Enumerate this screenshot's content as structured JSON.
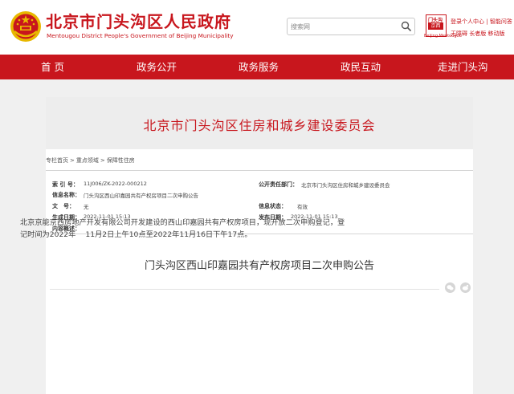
{
  "header": {
    "title": "北京市门头沟区人民政府",
    "subtitle": "Mentougou District People's Government of Beijing Municipality",
    "search_placeholder": "搜索网",
    "logo_top": "门头沟",
    "logo_mid": "京西",
    "logo_text": "Beijing·Mentougou",
    "links_row1": [
      "登录个人中心",
      "智能问答"
    ],
    "links_row2": [
      "无障碍",
      "长者版",
      "移动版"
    ]
  },
  "nav": {
    "items": [
      "首 页",
      "政务公开",
      "政务服务",
      "政民互动",
      "走进门头沟"
    ]
  },
  "banner": {
    "title": "北京市门头沟区住房和城乡建设委员会"
  },
  "breadcrumb": [
    "专栏首页",
    "重点领域",
    "保障性住房"
  ],
  "meta": {
    "index_label": "索 引 号：",
    "index_value": "11J006/ZK-2022-000212",
    "org_label": "公开责任部门：",
    "org_value": "北京市门头沟区住房和城乡建设委员会",
    "name_label": "信息名称：",
    "name_value": "门头沟区西山印嘉园共有产权房项目二次申购公告",
    "docno_label": "文　号：",
    "docno_value": "无",
    "status_label": "信息状态：",
    "status_value": "有效",
    "created_label": "生成日期：",
    "created_value": "2022-11-01 15:13",
    "published_label": "发布日期：",
    "published_value": "2022-11-01 15:13",
    "summary_label": "内容概述："
  },
  "article": {
    "title": "门头沟区西山印嘉园共有产权房项目二次申购公告",
    "body_line1": "北京京能京西房地产开发有限公司开发建设的西山印嘉园共有产权房项目，现开放二次申购登记，登",
    "body_line2": "记时间为2022年　 11月2日上午10点至2022年11月16日下午17点。"
  },
  "share": {
    "icons": [
      "wechat-icon",
      "weibo-icon"
    ]
  },
  "colors": {
    "brand_red": "#c8161d",
    "page_gray": "#f0f0f0"
  }
}
